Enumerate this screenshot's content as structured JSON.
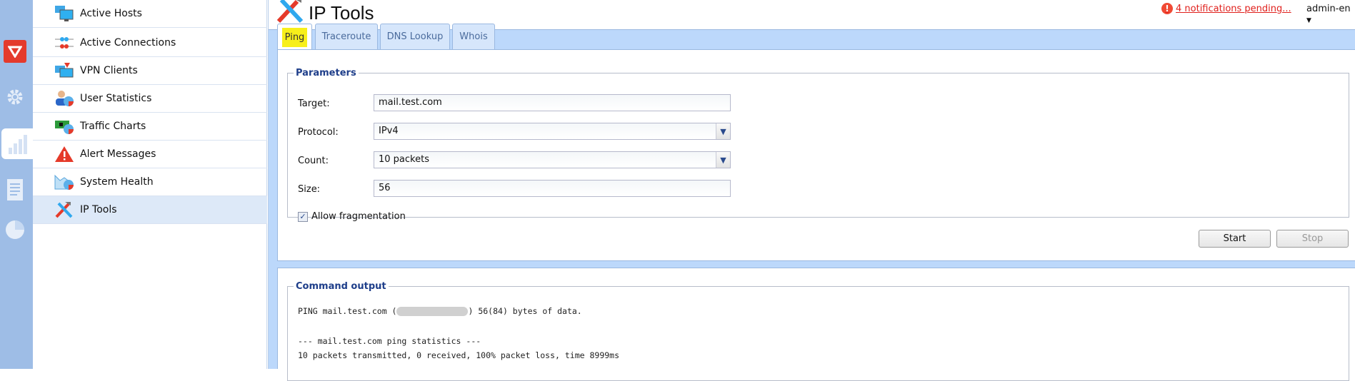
{
  "rail": {
    "items": [
      {
        "icon": "shield-icon"
      },
      {
        "icon": "gear-icon"
      },
      {
        "icon": "bar-chart-icon",
        "active": true
      },
      {
        "icon": "document-icon"
      },
      {
        "icon": "pie-chart-icon"
      }
    ]
  },
  "sidebar": {
    "items": [
      {
        "label": "Active Hosts",
        "icon": "hosts-icon"
      },
      {
        "label": "Active Connections",
        "icon": "connections-icon"
      },
      {
        "label": "VPN Clients",
        "icon": "vpn-clients-icon"
      },
      {
        "label": "User Statistics",
        "icon": "user-statistics-icon"
      },
      {
        "label": "Traffic Charts",
        "icon": "traffic-charts-icon"
      },
      {
        "label": "Alert Messages",
        "icon": "alert-icon"
      },
      {
        "label": "System Health",
        "icon": "system-health-icon"
      },
      {
        "label": "IP Tools",
        "icon": "ip-tools-icon",
        "selected": true
      }
    ]
  },
  "header": {
    "title": "IP Tools",
    "notifications": "4 notifications pending...",
    "user": "admin-en"
  },
  "tabs": [
    {
      "label": "Ping",
      "active": true
    },
    {
      "label": "Traceroute"
    },
    {
      "label": "DNS Lookup"
    },
    {
      "label": "Whois"
    }
  ],
  "parameters": {
    "legend": "Parameters",
    "target_label": "Target:",
    "target_value": "mail.test.com",
    "protocol_label": "Protocol:",
    "protocol_value": "IPv4",
    "count_label": "Count:",
    "count_value": "10 packets",
    "size_label": "Size:",
    "size_value": "56",
    "fragmentation_label": "Allow fragmentation",
    "fragmentation_checked": true
  },
  "buttons": {
    "start": "Start",
    "stop": "Stop"
  },
  "output": {
    "legend": "Command output",
    "line1_prefix": "PING mail.test.com (",
    "line1_suffix": ") 56(84) bytes of data.",
    "line2": "--- mail.test.com ping statistics ---",
    "line3": "10 packets transmitted, 0 received, 100% packet loss, time 8999ms"
  },
  "colors": {
    "accent": "#bcd8fb",
    "notification": "#e0201c",
    "legend": "#1e3e8a",
    "highlight": "#f7ef1a"
  }
}
